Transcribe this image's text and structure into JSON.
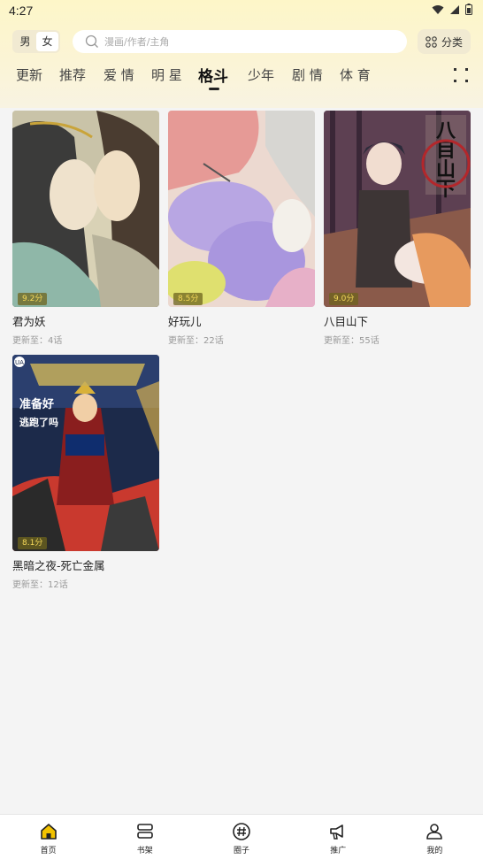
{
  "status": {
    "time": "4:27"
  },
  "header": {
    "gender_options": [
      "男",
      "女"
    ],
    "gender_selected": "女",
    "search_placeholder": "漫画/作者/主角",
    "category_label": "分类"
  },
  "tabs": [
    {
      "label": "更新",
      "active": false
    },
    {
      "label": "推荐",
      "active": false
    },
    {
      "label": "爱 情",
      "active": false
    },
    {
      "label": "明 星",
      "active": false
    },
    {
      "label": "格斗",
      "active": true
    },
    {
      "label": "少年",
      "active": false
    },
    {
      "label": "剧 情",
      "active": false
    },
    {
      "label": "体 育",
      "active": false
    }
  ],
  "comics": [
    {
      "title": "君为妖",
      "score": "9.2分",
      "update": "更新至：4话"
    },
    {
      "title": "好玩儿",
      "score": "8.5分",
      "update": "更新至：22话"
    },
    {
      "title": "八目山下",
      "score": "9.0分",
      "update": "更新至：55话"
    },
    {
      "title": "黑暗之夜-死亡金属",
      "score": "8.1分",
      "update": "更新至：12话"
    }
  ],
  "cover_texts": {
    "comic3_logo": "八目山下",
    "comic4_text": "准备好 逃跑了吗"
  },
  "bottom_nav": [
    {
      "label": "首页",
      "icon": "home-icon",
      "active": true
    },
    {
      "label": "书架",
      "icon": "bookshelf-icon",
      "active": false
    },
    {
      "label": "圈子",
      "icon": "hashtag-icon",
      "active": false
    },
    {
      "label": "推广",
      "icon": "megaphone-icon",
      "active": false
    },
    {
      "label": "我的",
      "icon": "user-icon",
      "active": false
    }
  ],
  "colors": {
    "accent": "#f5d95a",
    "header_bg": "#fdf6c8",
    "nav_active": "#f2c200"
  }
}
